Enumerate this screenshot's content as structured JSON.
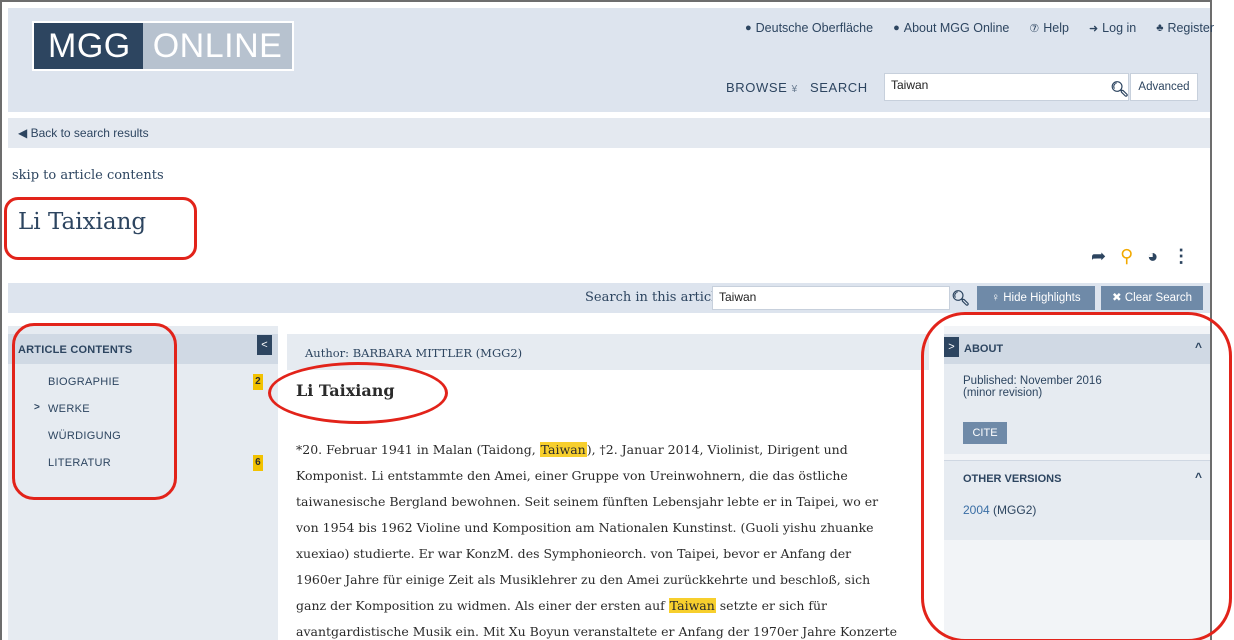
{
  "header": {
    "logo_left": "MGG",
    "logo_right": "ONLINE",
    "links": [
      {
        "icon": "globe-icon",
        "glyph": "●",
        "label": "Deutsche Oberfläche"
      },
      {
        "icon": "info-icon",
        "glyph": "●",
        "label": "About MGG Online"
      },
      {
        "icon": "help-icon",
        "glyph": "?",
        "label": "Help"
      },
      {
        "icon": "login-icon",
        "glyph": "➜",
        "label": "Log in"
      },
      {
        "icon": "register-icon",
        "glyph": "+",
        "label": "Register"
      }
    ],
    "browse_label": "BROWSE",
    "search_label": "SEARCH",
    "search_value": "Taiwan",
    "advanced_label": "Advanced"
  },
  "back_link": "Back to search results",
  "skip_link": "skip to article contents",
  "page_title": "Li Taixiang",
  "article_search": {
    "label": "Search in this article:",
    "value": "Taiwan",
    "hide_label": "Hide Highlights",
    "clear_label": "Clear Search"
  },
  "toc": {
    "title": "ARTICLE CONTENTS",
    "items": [
      {
        "label": "BIOGRAPHIE",
        "count": "2",
        "active": false
      },
      {
        "label": "WERKE",
        "count": "",
        "active": true
      },
      {
        "label": "WÜRDIGUNG",
        "count": "",
        "active": false
      },
      {
        "label": "LITERATUR",
        "count": "6",
        "active": false
      }
    ]
  },
  "article": {
    "author": "Author: BARBARA MITTLER (MGG2)",
    "title": "Li Taixiang",
    "lines": [
      [
        "*20. Februar 1941 in Malan (Taidong, ",
        "Taiwan",
        "), †2. Januar 2014, Violinist, Dirigent und"
      ],
      [
        "Komponist. Li entstammte den Amei, einer Gruppe von Ureinwohnern, die das östliche",
        "",
        ""
      ],
      [
        "taiwanesische Bergland bewohnen. Seit seinem fünften Lebensjahr lebte er in Taipei, wo er",
        "",
        ""
      ],
      [
        "von 1954 bis 1962 Violine und Komposition am Nationalen Kunstinst. (Guoli yishu zhuanke",
        "",
        ""
      ],
      [
        "xuexiao) studierte. Er war KonzM. des Symphonieorch. von Taipei, bevor er Anfang der",
        "",
        ""
      ],
      [
        "1960er Jahre für einige Zeit als Musiklehrer zu den Amei zurückkehrte und beschloß, sich",
        "",
        ""
      ],
      [
        "ganz der Komposition zu widmen. Als einer der ersten auf ",
        "Taiwan",
        " setzte er sich für"
      ],
      [
        "avantgardistische Musik ein. Mit Xu Boyun veranstaltete er Anfang der 1970er Jahre Konzerte",
        "",
        ""
      ]
    ]
  },
  "about": {
    "title": "ABOUT",
    "published": "Published: November 2016",
    "revision": "(minor revision)",
    "cite_label": "CITE",
    "other_versions_title": "OTHER VERSIONS",
    "version_year": "2004",
    "version_label": " (MGG2)"
  },
  "colors": {
    "navy": "#2d4560",
    "highlight": "#f7cf2d",
    "annotation_red": "#e2231a",
    "button_blue": "#6f8aa8"
  }
}
